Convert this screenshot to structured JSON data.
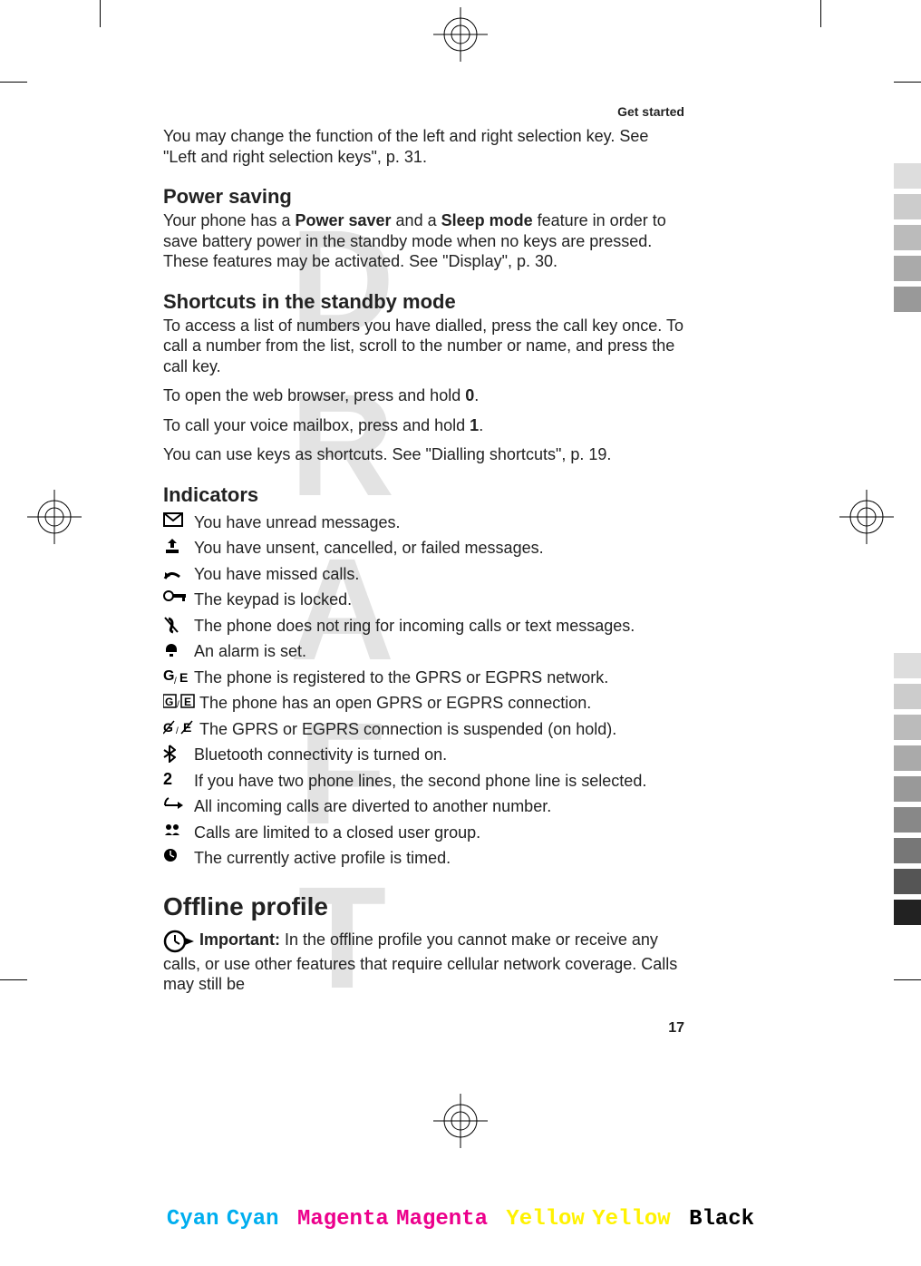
{
  "header": {
    "section_label": "Get started"
  },
  "intro": {
    "selection_keys": "You may change the function of the left and right selection key. See \"Left and right selection keys\", p. 31."
  },
  "power_saving": {
    "heading": "Power saving",
    "text_parts": {
      "a": "Your phone has a ",
      "b": "Power saver",
      "c": " and a ",
      "d": "Sleep mode",
      "e": " feature in order to save battery power in the standby mode when no keys are pressed. These features may be activated. See \"Display\", p. 30."
    }
  },
  "shortcuts": {
    "heading": "Shortcuts in the standby mode",
    "p1": "To access a list of numbers you have dialled, press the call key once. To call a number from the list, scroll to the number or name, and press the call key.",
    "p2_a": "To open the web browser, press and hold ",
    "p2_b": "0",
    "p2_c": ".",
    "p3_a": "To call your voice mailbox, press and hold ",
    "p3_b": "1",
    "p3_c": ".",
    "p4": "You can use keys as shortcuts. See \"Dialling shortcuts\", p. 19."
  },
  "indicators": {
    "heading": "Indicators",
    "items": [
      {
        "icon": "envelope-icon",
        "text": "You have unread messages."
      },
      {
        "icon": "outbox-icon",
        "text": "You have unsent, cancelled, or failed messages."
      },
      {
        "icon": "missed-call-icon",
        "text": "You have missed calls."
      },
      {
        "icon": "key-lock-icon",
        "text": "The keypad is locked."
      },
      {
        "icon": "silent-icon",
        "text": "The phone does not ring for incoming calls or text messages."
      },
      {
        "icon": "alarm-icon",
        "text": "An alarm is set."
      },
      {
        "icon": "g-e-icon",
        "text": "The phone is registered to the GPRS or EGPRS network."
      },
      {
        "icon": "g-e-box-icon",
        "text": "The phone has an open GPRS or EGPRS connection."
      },
      {
        "icon": "g-e-slash-icon",
        "text": "The GPRS or EGPRS connection is suspended (on hold)."
      },
      {
        "icon": "bluetooth-icon",
        "text": "Bluetooth connectivity is turned on."
      },
      {
        "icon": "line2-icon",
        "text": "If you have two phone lines, the second phone line is selected."
      },
      {
        "icon": "divert-icon",
        "text": "All incoming calls are diverted to another number."
      },
      {
        "icon": "closed-group-icon",
        "text": "Calls are limited to a closed user group."
      },
      {
        "icon": "timer-icon",
        "text": "The currently active profile is timed."
      }
    ]
  },
  "offline": {
    "heading": "Offline profile",
    "important_label": "Important:",
    "important_text": "  In the offline profile you cannot make or receive any calls, or use other features that require cellular network coverage. Calls may still be"
  },
  "page_number": "17",
  "watermark": "DRAFT",
  "footer": {
    "cyan": "Cyan",
    "magenta": "Magenta",
    "yellow": "Yellow",
    "black": "Black"
  }
}
